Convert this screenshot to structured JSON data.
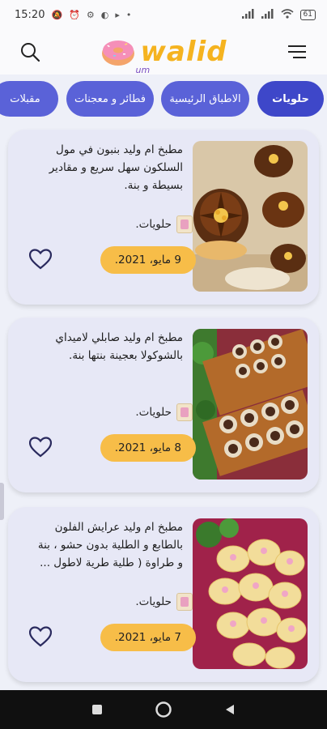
{
  "status": {
    "time": "15:20",
    "battery": "61"
  },
  "header": {
    "logo_text": "walid",
    "logo_sub": "um"
  },
  "tabs": [
    {
      "label": "حلويات",
      "active": true
    },
    {
      "label": "الاطباق الرئيسية",
      "active": false
    },
    {
      "label": "فطائر و معجنات",
      "active": false
    },
    {
      "label": "مقبلات",
      "active": false
    }
  ],
  "posts": [
    {
      "title": "مطبخ ام وليد بنبون في مول السلكون سهل سريع و مقادير بسيطة و بنة.",
      "category": "حلويات.",
      "date": "9 مايو، 2021."
    },
    {
      "title": "مطبخ ام وليد صابلي لاميداي بالشوكولا بعجينة بنتها بنة.",
      "category": "حلويات.",
      "date": "8 مايو، 2021."
    },
    {
      "title": "مطبخ ام وليد عرايش الفلون بالطابع و الطلية بدون حشو ، بنة و طراوة ( طلية طرية لاطول ...",
      "category": "حلويات.",
      "date": "7 مايو، 2021."
    }
  ],
  "colors": {
    "tab_active": "#3e47c9",
    "tab": "#5a62d8",
    "date_pill": "#f7bd48",
    "card_bg": "#e7e8f6",
    "logo": "#f5b31f"
  }
}
